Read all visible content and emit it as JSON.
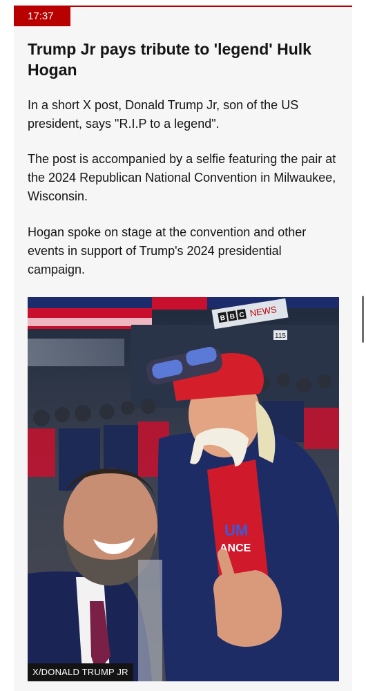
{
  "post": {
    "time": "17:37",
    "headline": "Trump Jr pays tribute to 'legend' Hulk Hogan",
    "paragraphs": [
      "In a short X post, Donald Trump Jr, son of the US president, says \"R.I.P to a legend\".",
      "The post is accompanied by a selfie featuring the pair at the 2024 Republican National Convention in Milwaukee, Wisconsin.",
      "Hogan spoke on stage at the convention and other events in support of Trump's 2024 presidential campaign."
    ],
    "image": {
      "caption": "X/DONALD TRUMP JR",
      "sign_text": "NEWS",
      "sign_logo": "BBC",
      "sign_number": "115",
      "shirt_text_1": "UM",
      "shirt_text_2": "ANCE"
    }
  },
  "colors": {
    "accent": "#b80000",
    "card_background": "#f6f6f6",
    "text": "#141414"
  }
}
